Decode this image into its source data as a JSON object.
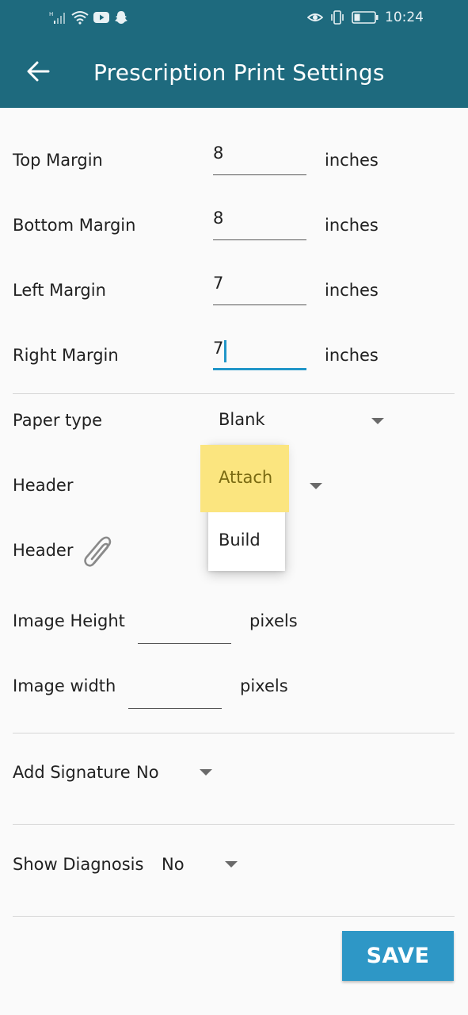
{
  "status_bar": {
    "time": "10:24",
    "icons": [
      "signal-icon",
      "wifi-icon",
      "youtube-icon",
      "snapchat-icon",
      "eye-icon",
      "vibrate-icon",
      "battery-icon"
    ]
  },
  "header": {
    "title": "Prescription Print Settings",
    "back_icon": "arrow-left-icon"
  },
  "margins": {
    "top": {
      "label": "Top Margin",
      "value": "8",
      "unit": "inches"
    },
    "bottom": {
      "label": "Bottom Margin",
      "value": "8",
      "unit": "inches"
    },
    "left": {
      "label": "Left Margin",
      "value": "7",
      "unit": "inches"
    },
    "right": {
      "label": "Right Margin",
      "value": "7",
      "unit": "inches"
    }
  },
  "paper_type": {
    "label": "Paper type",
    "value": "Blank"
  },
  "header_select": {
    "label": "Header",
    "options": [
      "Attach",
      "Build"
    ],
    "highlighted": "Attach"
  },
  "header_attach": {
    "label": "Header",
    "icon": "paperclip-icon"
  },
  "image_height": {
    "label": "Image Height",
    "value": "",
    "unit": "pixels"
  },
  "image_width": {
    "label": "Image width",
    "value": "",
    "unit": "pixels"
  },
  "add_signature": {
    "label": "Add Signature",
    "value": "No"
  },
  "show_diagnosis": {
    "label": "Show Diagnosis",
    "value": "No"
  },
  "save_button": {
    "label": "SAVE"
  },
  "colors": {
    "appbar": "#1e6a7e",
    "accent": "#2196c8",
    "save": "#2e97c6",
    "highlight": "#fbe57f"
  }
}
